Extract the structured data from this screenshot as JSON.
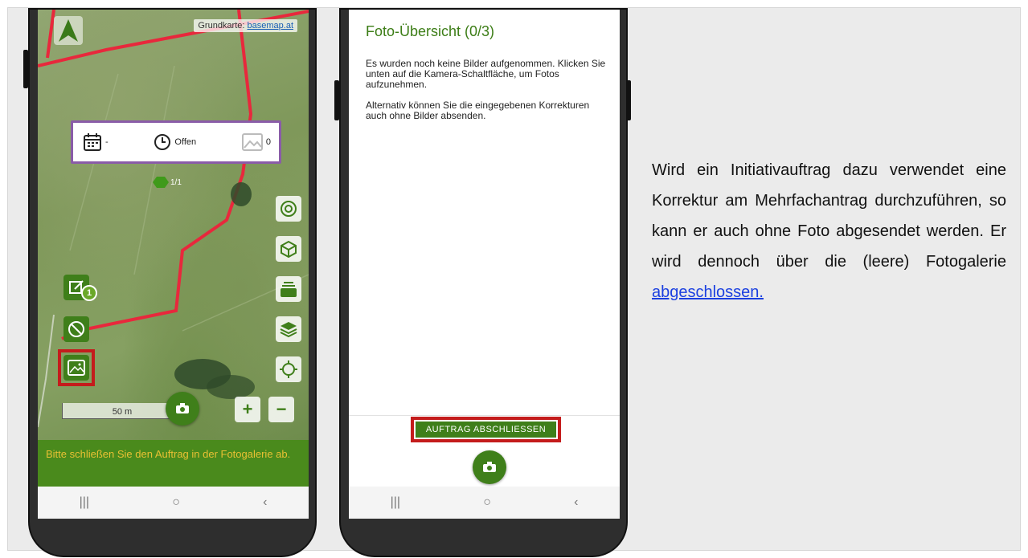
{
  "map_screen": {
    "attribution_prefix": "Grundkarte:",
    "attribution_link": "basemap.at",
    "info_card": {
      "date_value": "-",
      "status_value": "Offen",
      "photo_count": "0"
    },
    "parcel_badge": "1/1",
    "correction_badge": "1",
    "scale_label": "50 m",
    "zoom_in": "+",
    "zoom_out": "−",
    "hint": "Bitte schließen Sie den Auftrag in der Fotogalerie ab.",
    "icons": [
      "navigation-arrow-icon",
      "calendar-icon",
      "clock-icon",
      "image-icon",
      "hexagon-icon",
      "target-icon",
      "cube-icon",
      "layers-card-icon",
      "stack-icon",
      "crosshair-icon",
      "edit-note-icon",
      "block-icon",
      "gallery-icon",
      "camera-icon"
    ]
  },
  "photo_screen": {
    "title": "Foto-Übersicht (0/3)",
    "paragraph_1": "Es wurden noch keine Bilder aufgenommen. Klicken Sie unten auf die Kamera-Schaltfläche, um Fotos aufzunehmen.",
    "paragraph_2": "Alternativ können Sie die eingegebenen Korrekturen auch ohne Bilder absenden.",
    "finish_button": "AUFTRAG ABSCHLIESSEN"
  },
  "nav_bar": {
    "recent": "|||",
    "home": "○",
    "back": "‹"
  },
  "description": {
    "text": "Wird ein Initiativauftrag dazu verwendet eine Korrektur am Mehrfachantrag durchzuführen, so kann er auch ohne Foto abgesendet werden. Er wird dennoch über die (leere) Fotogalerie",
    "link": "abgeschlossen."
  },
  "colors": {
    "primary_green": "#3f7f1a",
    "hint_text": "#e8c033",
    "highlight_red": "#c41c1c",
    "parcel_red": "#e8283c",
    "card_border": "#8a5ca8"
  }
}
